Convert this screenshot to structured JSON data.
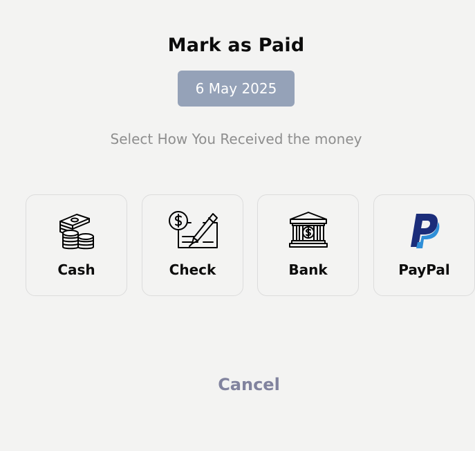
{
  "dialog": {
    "title": "Mark as Paid",
    "date": "6 May 2025",
    "instruction": "Select How You Received the money"
  },
  "methods": [
    {
      "label": "Cash",
      "icon": "cash-icon"
    },
    {
      "label": "Check",
      "icon": "check-icon"
    },
    {
      "label": "Bank",
      "icon": "bank-icon"
    },
    {
      "label": "PayPal",
      "icon": "paypal-icon"
    }
  ],
  "actions": {
    "cancel_label": "Cancel"
  },
  "colors": {
    "background": "#f3f3f2",
    "date_badge": "#95a2b8",
    "cancel_text": "#81839e",
    "card_border": "#dcdcdc",
    "paypal_dark": "#1b2d7a",
    "paypal_light": "#2f8fd8"
  }
}
